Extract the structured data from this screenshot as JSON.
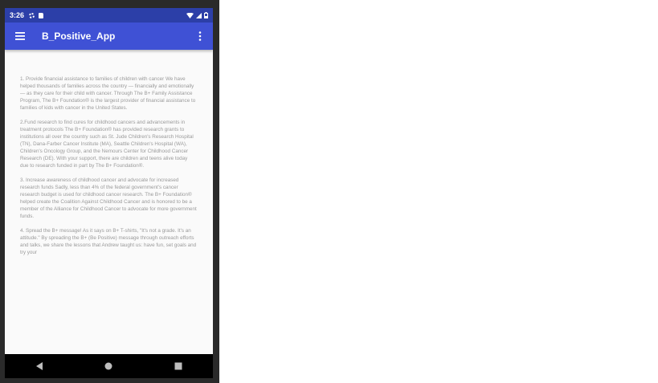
{
  "status_bar": {
    "time": "3:26",
    "left_icons": [
      "settings-icon",
      "sd-card-icon"
    ],
    "right_icons": [
      "wifi-icon",
      "signal-icon",
      "battery-icon"
    ]
  },
  "app_bar": {
    "title": "B_Positive_App",
    "menu_icon": "hamburger-menu-icon",
    "overflow_icon": "more-vert-icon"
  },
  "colors": {
    "status_bar": "#2c3fa8",
    "app_bar": "#3f51d5",
    "body_text": "#9a9a9a",
    "nav_bar": "#000000"
  },
  "content": {
    "paragraphs": [
      "1. Provide financial assistance to families of children with cancer We have helped thousands of families across the country — financially and emotionally — as they care for their child with cancer. Through The B+ Family Assistance Program, The B+ Foundation® is the largest provider of financial assistance to families of kids with cancer in the United States.",
      "2.Fund research to find cures for childhood cancers and advancements in treatment protocols The B+ Foundation® has provided research grants to institutions all over the country such as St. Jude Children's Research Hospital (TN), Dana-Farber Cancer Institute (MA), Seattle Children's Hospital (WA), Children's Oncology Group, and the Nemours Center for Childhood Cancer Research (DE). With your support, there are children and teens alive today due to research funded in part by The B+ Foundation®.",
      "3. Increase awareness of childhood cancer and advocate for increased research funds Sadly, less than 4% of the federal government's cancer research budget is used for childhood cancer research. The B+ Foundation® helped create the Coalition Against Childhood Cancer and is honored to be a member of the Alliance for Childhood Cancer to advocate for more government funds.",
      "4. Spread the B+ message! As it says on B+ T-shirts, \"It's not a grade. It's an attitude.\" By spreading the B+ (Be Positive) message through outreach efforts and talks, we share the lessons that Andrew taught us: have fun, set goals and try your"
    ]
  },
  "nav_bar": {
    "buttons": [
      "back-icon",
      "home-icon",
      "recents-icon"
    ]
  }
}
